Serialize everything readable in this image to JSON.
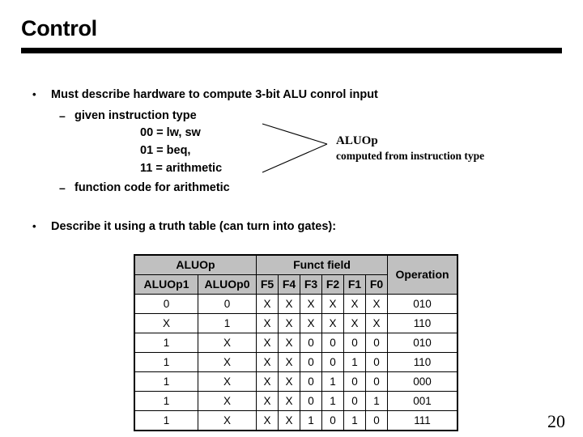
{
  "slide": {
    "title": "Control",
    "page_number": "20"
  },
  "bullets": [
    {
      "marker": "•",
      "text": "Must describe hardware to compute 3-bit ALU conrol input"
    },
    {
      "marker": "•",
      "text": "Describe it using a truth table (can turn into gates):"
    }
  ],
  "sub_bullets": [
    {
      "marker": "–",
      "text": "given instruction type"
    },
    {
      "marker": "–",
      "text": "function code for arithmetic"
    }
  ],
  "code_lines": [
    "00 = lw, sw",
    "01 = beq,",
    "11 = arithmetic"
  ],
  "callout": {
    "title": "ALUOp",
    "subtitle": "computed from instruction type"
  },
  "table": {
    "group_headers": [
      {
        "label": "ALUOp",
        "colspan": 2
      },
      {
        "label": "Funct field",
        "colspan": 6
      },
      {
        "label": "Operation",
        "colspan": 1
      }
    ],
    "column_headers": [
      "ALUOp1",
      "ALUOp0",
      "F5",
      "F4",
      "F3",
      "F2",
      "F1",
      "F0"
    ],
    "rows": [
      [
        "0",
        "0",
        "X",
        "X",
        "X",
        "X",
        "X",
        "X",
        "010"
      ],
      [
        "X",
        "1",
        "X",
        "X",
        "X",
        "X",
        "X",
        "X",
        "110"
      ],
      [
        "1",
        "X",
        "X",
        "X",
        "0",
        "0",
        "0",
        "0",
        "010"
      ],
      [
        "1",
        "X",
        "X",
        "X",
        "0",
        "0",
        "1",
        "0",
        "110"
      ],
      [
        "1",
        "X",
        "X",
        "X",
        "0",
        "1",
        "0",
        "0",
        "000"
      ],
      [
        "1",
        "X",
        "X",
        "X",
        "0",
        "1",
        "0",
        "1",
        "001"
      ],
      [
        "1",
        "X",
        "X",
        "X",
        "1",
        "0",
        "1",
        "0",
        "111"
      ]
    ]
  },
  "colors": {
    "header_fill": "#c0c0c0",
    "rule": "#000000",
    "text": "#000000"
  }
}
